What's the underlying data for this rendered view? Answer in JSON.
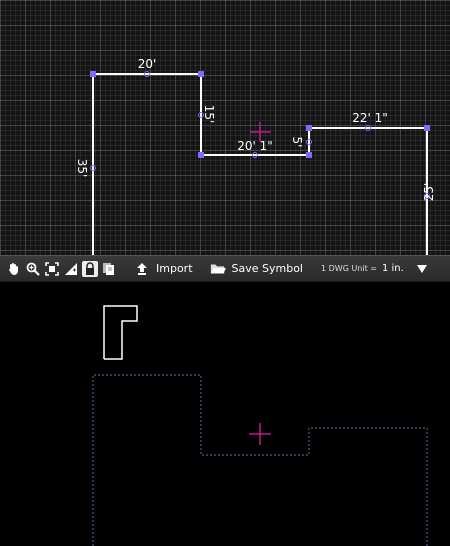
{
  "drawing": {
    "dimensions": {
      "top_left": "20'",
      "right_drop": "15'",
      "middle": "20' 1\"",
      "step": "5'",
      "top_right": "22' 1\"",
      "left": "35'",
      "right": "25'"
    }
  },
  "toolbar": {
    "icons": [
      "hand-icon",
      "zoom-icon",
      "fit-icon",
      "scale-icon",
      "lock-icon",
      "copy-icon"
    ],
    "import_label": "Import",
    "save_symbol_label": "Save Symbol",
    "unit_label": "1 DWG Unit =",
    "unit_value": "1 in."
  },
  "colors": {
    "line": "#ffffff",
    "vertex": "#7b6cff",
    "crosshair": "#c0188c",
    "dashed": "#4a7aa8"
  }
}
